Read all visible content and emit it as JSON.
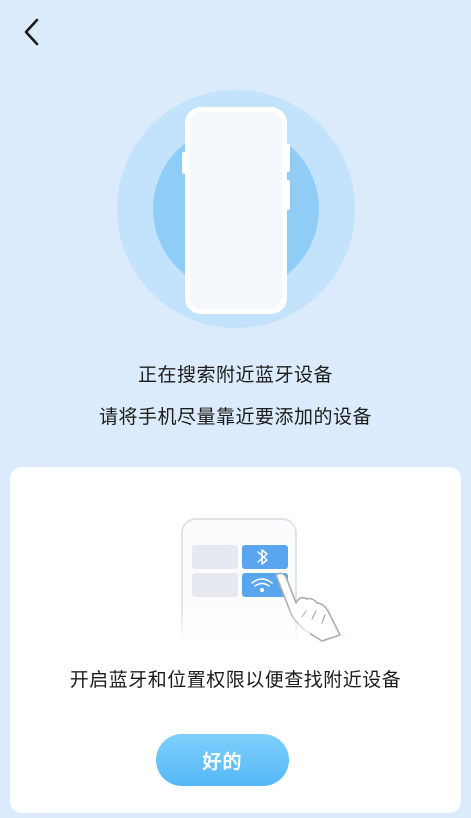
{
  "nav": {
    "back_icon": "chevron-left-icon"
  },
  "hero": {
    "icon": "phone-searching-illustration"
  },
  "status": {
    "line1": "正在搜索附近蓝牙设备",
    "line2": "请将手机尽量靠近要添加的设备"
  },
  "permission_card": {
    "illustration": "control-center-bluetooth-wifi-illustration",
    "message": "开启蓝牙和位置权限以便查找附近设备",
    "ok_label": "好的"
  },
  "colors": {
    "background": "#dcebfb",
    "ring_outer": "#c3e2fb",
    "ring_inner": "#8fcdf6",
    "button": "#55b7f6",
    "tile_active": "#5aa6ee"
  }
}
